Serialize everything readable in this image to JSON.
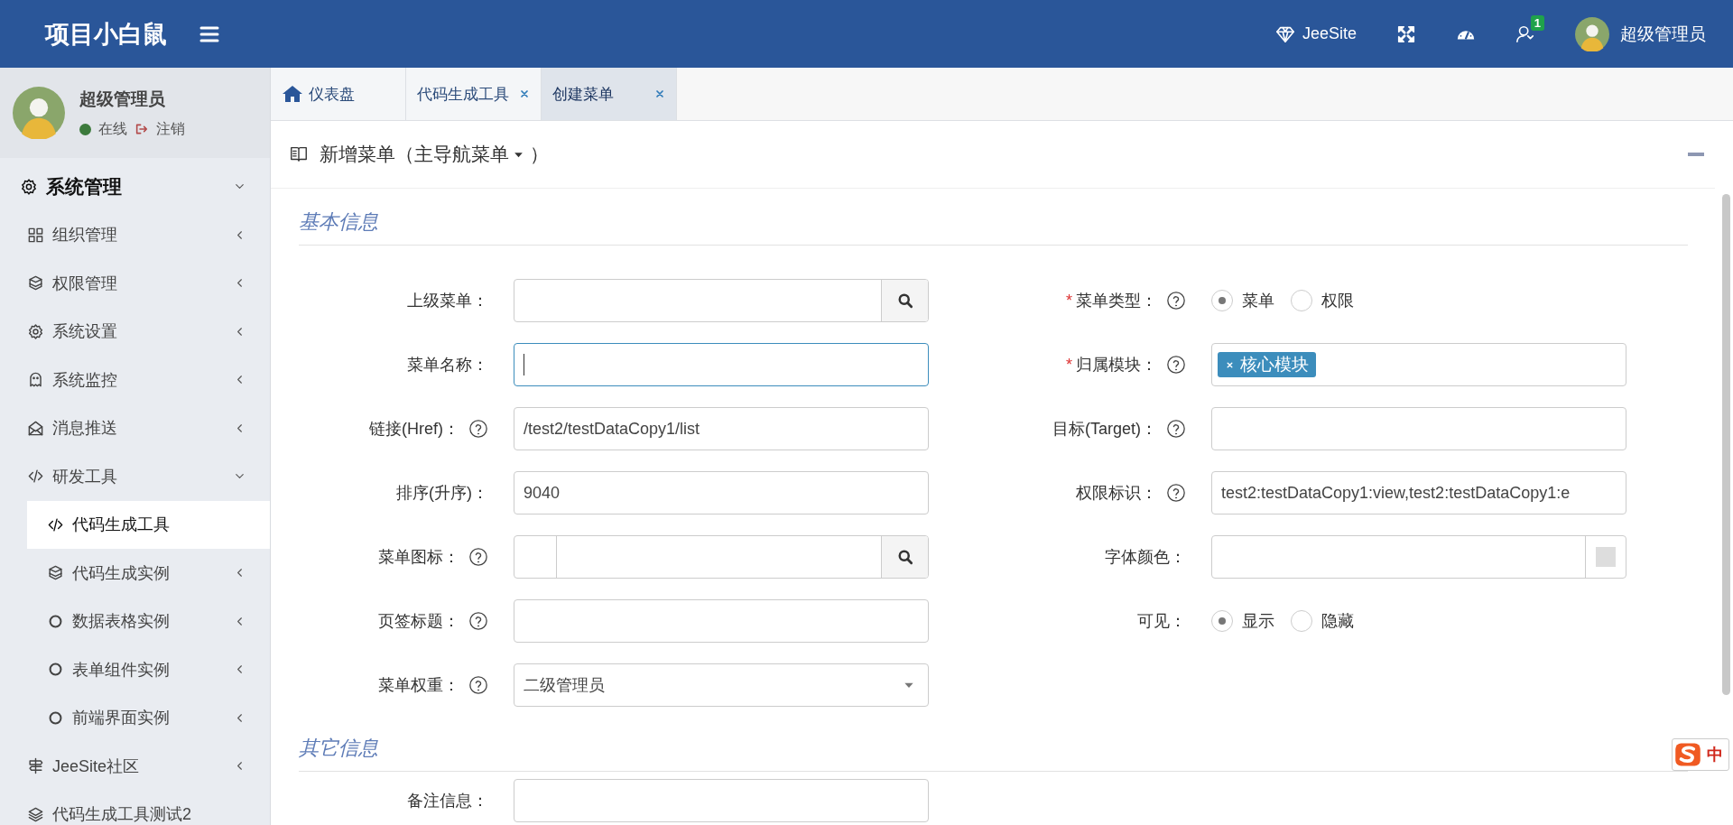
{
  "header": {
    "logo": "项目小白鼠",
    "link": "JeeSite",
    "notification_count": "1",
    "user": "超级管理员"
  },
  "user_panel": {
    "name": "超级管理员",
    "status": "在线",
    "logout": "注销"
  },
  "sidebar": {
    "items": [
      {
        "label": "系统管理",
        "kind": "gear",
        "expanded": true,
        "selected": false,
        "children": [
          {
            "label": "组织管理",
            "kind": "grid",
            "expanded": false,
            "selected": false
          },
          {
            "label": "权限管理",
            "kind": "cube",
            "expanded": false,
            "selected": false
          },
          {
            "label": "系统设置",
            "kind": "gear",
            "expanded": false,
            "selected": false
          },
          {
            "label": "系统监控",
            "kind": "ghost",
            "expanded": false,
            "selected": false
          },
          {
            "label": "消息推送",
            "kind": "mail",
            "expanded": false,
            "selected": false
          },
          {
            "label": "研发工具",
            "kind": "code",
            "expanded": true,
            "selected": false,
            "children": [
              {
                "label": "代码生成工具",
                "kind": "code",
                "selected": true
              },
              {
                "label": "代码生成实例",
                "kind": "cube",
                "expanded": false,
                "selected": false
              },
              {
                "label": "数据表格实例",
                "kind": "circle",
                "expanded": false,
                "selected": false
              },
              {
                "label": "表单组件实例",
                "kind": "circle",
                "expanded": false,
                "selected": false
              },
              {
                "label": "前端界面实例",
                "kind": "circle",
                "expanded": false,
                "selected": false
              }
            ]
          },
          {
            "label": "JeeSite社区",
            "kind": "sign",
            "expanded": false,
            "selected": false
          },
          {
            "label": "代码生成工具测试2",
            "kind": "layers",
            "selected": false
          }
        ]
      }
    ]
  },
  "tabs": [
    {
      "label": "仪表盘",
      "kind": "home",
      "closable": false,
      "selected": false
    },
    {
      "label": "代码生成工具",
      "kind": "page",
      "closable": true,
      "selected": false
    },
    {
      "label": "创建菜单",
      "kind": "page",
      "closable": true,
      "selected": true
    }
  ],
  "panel": {
    "title": "新增菜单（主导航菜单",
    "title_end": "）",
    "sections": [
      {
        "title": "基本信息",
        "rows": [
          [
            {
              "label": "上级菜单：",
              "kind": "search"
            },
            {
              "label": "菜单类型：",
              "kind": "radio",
              "required_mark": "*",
              "help": true,
              "options": [
                {
                  "label": "菜单",
                  "selected": true
                },
                {
                  "label": "权限",
                  "selected": false
                }
              ]
            }
          ],
          [
            {
              "label": "菜单名称：",
              "kind": "text",
              "focused": true
            },
            {
              "label": "归属模块：",
              "kind": "tags",
              "required_mark": "*",
              "help": true,
              "tags": [
                "核心模块"
              ]
            }
          ],
          [
            {
              "label": "链接(Href)：",
              "kind": "text",
              "help": true,
              "value": "/test2/testDataCopy1/list"
            },
            {
              "label": "目标(Target)：",
              "kind": "text",
              "help": true
            }
          ],
          [
            {
              "label": "排序(升序)：",
              "kind": "text",
              "value": "9040"
            },
            {
              "label": "权限标识：",
              "kind": "text",
              "help": true,
              "value": "test2:testDataCopy1:view,test2:testDataCopy1:e"
            }
          ],
          [
            {
              "label": "菜单图标：",
              "kind": "iconsearch",
              "help": true
            },
            {
              "label": "字体颜色：",
              "kind": "color"
            }
          ],
          [
            {
              "label": "页签标题：",
              "kind": "text",
              "help": true
            },
            {
              "label": "可见：",
              "kind": "radio",
              "options": [
                {
                  "label": "显示",
                  "selected": true
                },
                {
                  "label": "隐藏",
                  "selected": false
                }
              ]
            }
          ],
          [
            {
              "label": "菜单权重：",
              "kind": "select",
              "help": true,
              "value": "二级管理员"
            }
          ]
        ]
      },
      {
        "title": "其它信息",
        "rows": [
          [
            {
              "label": "备注信息：",
              "kind": "text"
            }
          ]
        ]
      }
    ]
  },
  "ime": {
    "label": "中"
  }
}
